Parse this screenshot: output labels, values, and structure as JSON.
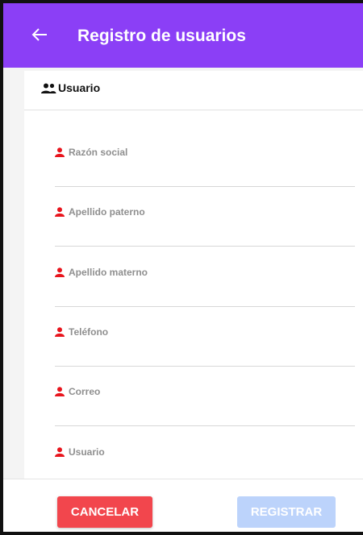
{
  "app_bar": {
    "title": "Registro de usuarios",
    "back_icon": "arrow-left-icon",
    "color": "#8b3ff6"
  },
  "section": {
    "title": "Usuario",
    "icon": "people-icon"
  },
  "fields": [
    {
      "label": "Razón social",
      "icon": "person-icon"
    },
    {
      "label": "Apellido paterno",
      "icon": "person-icon"
    },
    {
      "label": "Apellido materno",
      "icon": "person-icon"
    },
    {
      "label": "Teléfono",
      "icon": "person-icon"
    },
    {
      "label": "Correo",
      "icon": "person-icon"
    },
    {
      "label": "Usuario",
      "icon": "person-icon"
    }
  ],
  "field_icon_color": "#e8141c",
  "buttons": {
    "cancel_label": "CANCELAR",
    "cancel_color": "#f2464d",
    "register_label": "REGISTRAR",
    "register_color": "#bcd3fb"
  }
}
